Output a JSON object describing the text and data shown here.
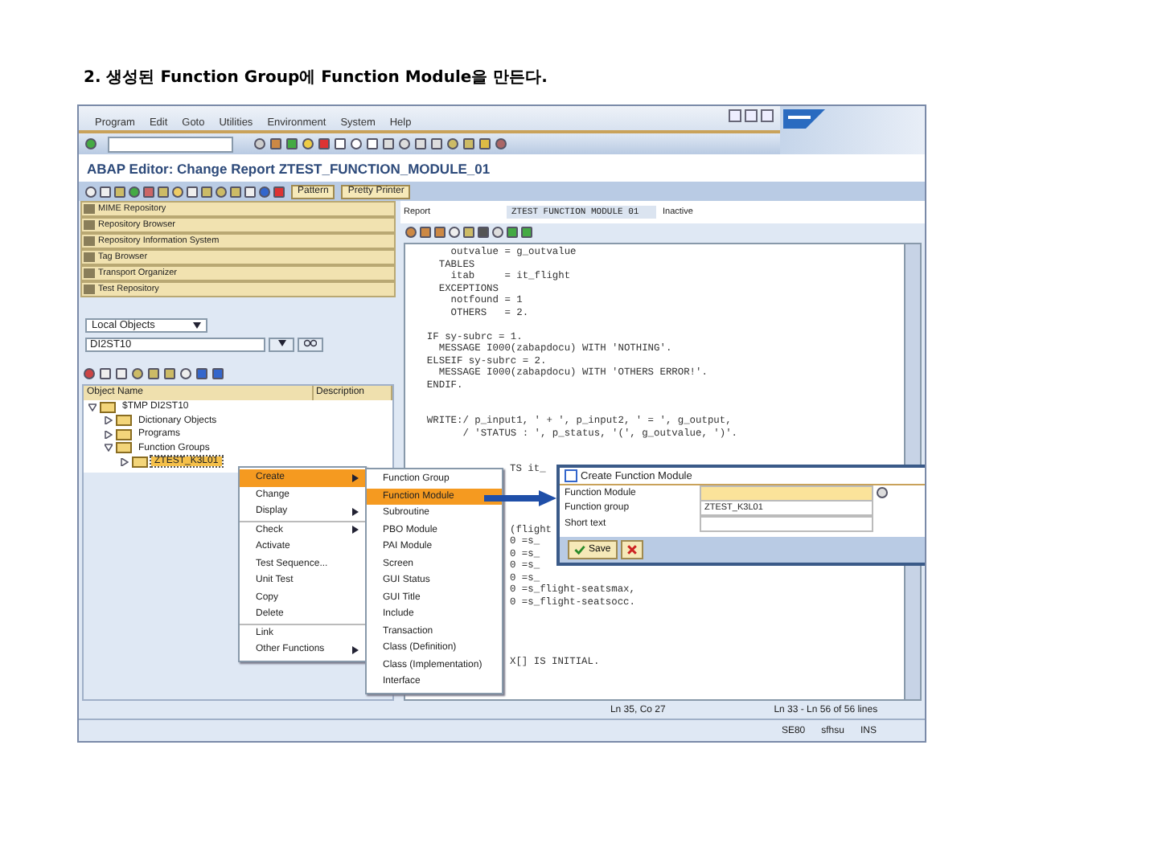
{
  "heading": "2. 생성된 Function Group에 Function Module을 만든다.",
  "menu_bar": {
    "items": [
      "Program",
      "Edit",
      "Goto",
      "Utilities",
      "Environment",
      "System",
      "Help"
    ]
  },
  "title": "ABAP Editor: Change Report ZTEST_FUNCTION_MODULE_01",
  "app_toolbar": {
    "buttons": [
      "Pattern",
      "Pretty Printer"
    ]
  },
  "navigator": {
    "items": [
      "MIME Repository",
      "Repository Browser",
      "Repository Information System",
      "Tag Browser",
      "Transport Organizer",
      "Test Repository"
    ],
    "object_type": "Local Objects",
    "object_name": "DI2ST10",
    "columns": [
      "Object Name",
      "Description"
    ],
    "tree": [
      {
        "label": "$TMP DI2ST10",
        "expanded": true,
        "selected": false,
        "children": [
          {
            "label": "Dictionary Objects",
            "expanded": false,
            "selected": false
          },
          {
            "label": "Programs",
            "expanded": false,
            "selected": false
          },
          {
            "label": "Function Groups",
            "expanded": true,
            "selected": false,
            "children": [
              {
                "label": "ZTEST_K3L01",
                "expanded": false,
                "selected": true
              }
            ]
          }
        ]
      }
    ]
  },
  "editor": {
    "report_label": "Report",
    "report_name": "ZTEST FUNCTION MODULE 01",
    "status": "Inactive",
    "lines": [
      {
        "kind": "full",
        "text": "      outvalue = g_outvalue"
      },
      {
        "kind": "full",
        "text": "    TABLES"
      },
      {
        "kind": "full",
        "text": "      itab     = it_flight"
      },
      {
        "kind": "full",
        "text": "    EXCEPTIONS"
      },
      {
        "kind": "full",
        "text": "      notfound = 1"
      },
      {
        "kind": "full",
        "text": "      OTHERS   = 2."
      },
      {
        "kind": "blank"
      },
      {
        "kind": "full",
        "text": "  IF sy-subrc = 1."
      },
      {
        "kind": "full",
        "text": "    MESSAGE I000(zabapdocu) WITH 'NOTHING'."
      },
      {
        "kind": "full",
        "text": "  ELSEIF sy-subrc = 2."
      },
      {
        "kind": "full",
        "text": "    MESSAGE I000(zabapdocu) WITH 'OTHERS ERROR!'."
      },
      {
        "kind": "full",
        "text": "  ENDIF."
      },
      {
        "kind": "blank"
      },
      {
        "kind": "blank"
      },
      {
        "kind": "full",
        "text": "  WRITE:/ p_input1, ' + ', p_input2, ' = ', g_output,"
      },
      {
        "kind": "full",
        "text": "        / 'STATUS : ', p_status, '(', g_outvalue, ')'."
      },
      {
        "kind": "blank"
      },
      {
        "kind": "blank"
      },
      {
        "kind": "right",
        "text": "TS it_"
      },
      {
        "kind": "blank"
      },
      {
        "kind": "blank"
      },
      {
        "kind": "blank"
      },
      {
        "kind": "blank"
      },
      {
        "kind": "right",
        "text": "(flight"
      },
      {
        "kind": "right",
        "text": "0 =s_"
      },
      {
        "kind": "right",
        "text": "0 =s_"
      },
      {
        "kind": "right",
        "text": "0 =s_"
      },
      {
        "kind": "right",
        "text": "0 =s_"
      },
      {
        "kind": "right",
        "text": "0 =s_flight-seatsmax,"
      },
      {
        "kind": "right",
        "text": "0 =s_flight-seatsocc."
      },
      {
        "kind": "blank"
      },
      {
        "kind": "blank"
      },
      {
        "kind": "blank"
      },
      {
        "kind": "blank"
      },
      {
        "kind": "right",
        "text": "X[] IS INITIAL."
      }
    ]
  },
  "context_menu": {
    "items": [
      {
        "label": "Create",
        "selected": true,
        "submenu": true,
        "divider_above": false
      },
      {
        "label": "Change",
        "selected": false,
        "submenu": false,
        "divider_above": false
      },
      {
        "label": "Display",
        "selected": false,
        "submenu": true,
        "divider_above": false
      },
      {
        "label": "Check",
        "selected": false,
        "submenu": true,
        "divider_above": true
      },
      {
        "label": "Activate",
        "selected": false,
        "submenu": false,
        "divider_above": false
      },
      {
        "label": "Test Sequence...",
        "selected": false,
        "submenu": false,
        "divider_above": false
      },
      {
        "label": "Unit Test",
        "selected": false,
        "submenu": false,
        "divider_above": false
      },
      {
        "label": "Copy",
        "selected": false,
        "submenu": false,
        "divider_above": false
      },
      {
        "label": "Delete",
        "selected": false,
        "submenu": false,
        "divider_above": false
      },
      {
        "label": "Link",
        "selected": false,
        "submenu": false,
        "divider_above": true
      },
      {
        "label": "Other Functions",
        "selected": false,
        "submenu": true,
        "divider_above": false
      }
    ]
  },
  "submenu": {
    "items": [
      {
        "label": "Function Group",
        "selected": false
      },
      {
        "label": "Function Module",
        "selected": true
      },
      {
        "label": "Subroutine",
        "selected": false
      },
      {
        "label": "PBO Module",
        "selected": false
      },
      {
        "label": "PAI Module",
        "selected": false
      },
      {
        "label": "Screen",
        "selected": false
      },
      {
        "label": "GUI Status",
        "selected": false
      },
      {
        "label": "GUI Title",
        "selected": false
      },
      {
        "label": "Include",
        "selected": false
      },
      {
        "label": "Transaction",
        "selected": false
      },
      {
        "label": "Class (Definition)",
        "selected": false
      },
      {
        "label": "Class (Implementation)",
        "selected": false
      },
      {
        "label": "Interface",
        "selected": false
      }
    ]
  },
  "dialog": {
    "title": "Create Function Module",
    "fields": [
      {
        "label": "Function Module",
        "required": true
      },
      {
        "label": "Function group",
        "value": "ZTEST_K3L01",
        "required": false
      },
      {
        "label": "Short text",
        "required": false
      }
    ],
    "buttons": [
      {
        "kind": "save",
        "label": "Save"
      },
      {
        "kind": "cancel"
      }
    ]
  },
  "status_bar": {
    "position": "Ln 35, Co 27",
    "range": "Ln 33 - Ln 56 of 56 lines"
  },
  "system_bar": {
    "transaction": "SE80",
    "server": "sfhsu",
    "mode": "INS"
  }
}
